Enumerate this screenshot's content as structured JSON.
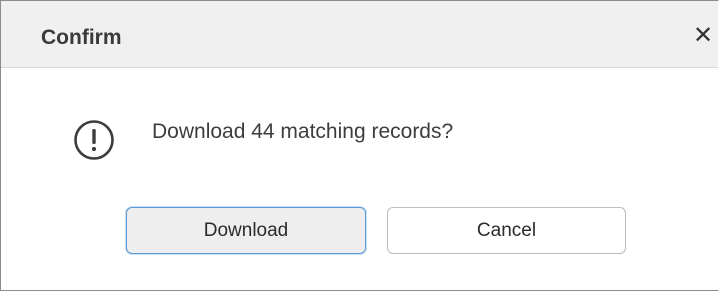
{
  "dialog": {
    "title": "Confirm",
    "close_glyph": "✕",
    "close_icon": "close-icon",
    "message_icon": "exclamation-circle-icon",
    "message": "Download 44 matching records?",
    "primary_button_label": "Download",
    "secondary_button_label": "Cancel"
  },
  "colors": {
    "titlebar_bg": "#f0f0f0",
    "primary_border": "#5a9ad6",
    "text": "#3d3d3d"
  }
}
